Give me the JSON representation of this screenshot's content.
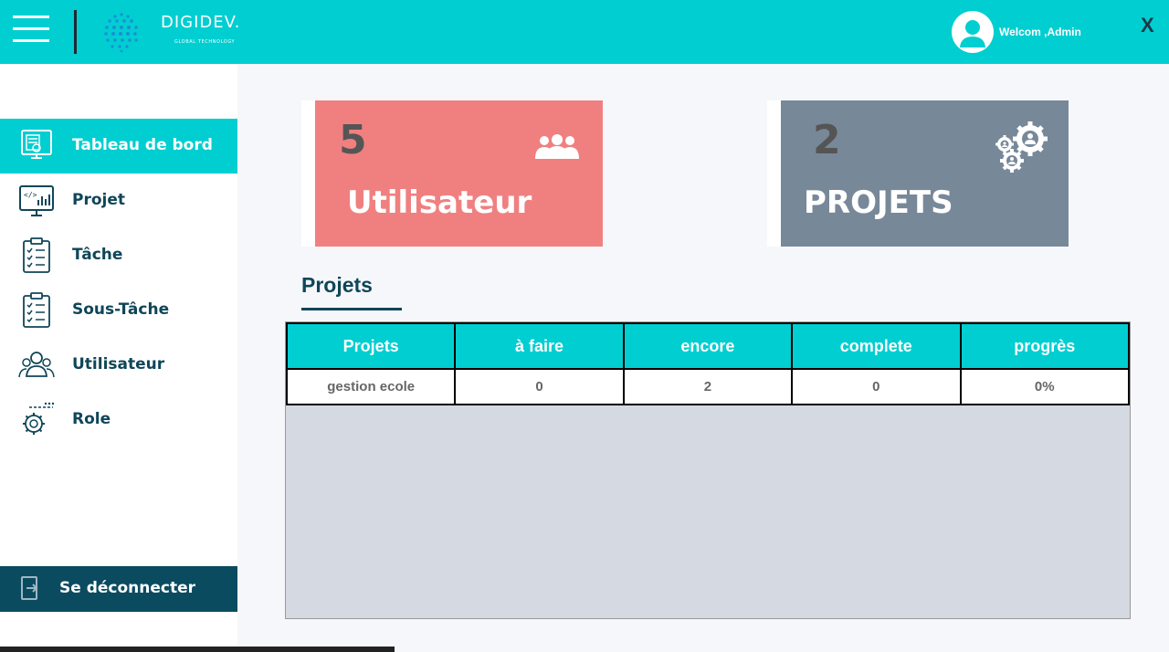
{
  "header": {
    "brand_name": "DIGIDEV.",
    "brand_tagline": "GLOBAL TECHNOLOGY",
    "welcome": "Welcom ,Admin",
    "close_label": "X",
    "accent_color": "#00ced1"
  },
  "sidebar": {
    "items": [
      {
        "label": "Tableau de bord",
        "icon": "dashboard-icon",
        "active": true
      },
      {
        "label": "Projet",
        "icon": "code-monitor-icon",
        "active": false
      },
      {
        "label": "Tâche",
        "icon": "clipboard-checklist-icon",
        "active": false
      },
      {
        "label": "Sous-Tâche",
        "icon": "clipboard-checklist-icon",
        "active": false
      },
      {
        "label": "Utilisateur",
        "icon": "users-icon",
        "active": false
      },
      {
        "label": "Role",
        "icon": "gear-icon",
        "active": false
      }
    ],
    "logout_label": "Se déconnecter"
  },
  "cards": [
    {
      "value": "5",
      "label": "Utilisateur",
      "color": "#f08080",
      "icon": "users-icon"
    },
    {
      "value": "2",
      "label": "PROJETS",
      "color": "#778899",
      "icon": "gears-icon"
    }
  ],
  "projects_section": {
    "title": "Projets",
    "columns": [
      "Projets",
      "à faire",
      "encore",
      "complete",
      "progrès"
    ],
    "rows": [
      [
        "gestion ecole",
        "0",
        "2",
        "0",
        "0%"
      ]
    ]
  }
}
